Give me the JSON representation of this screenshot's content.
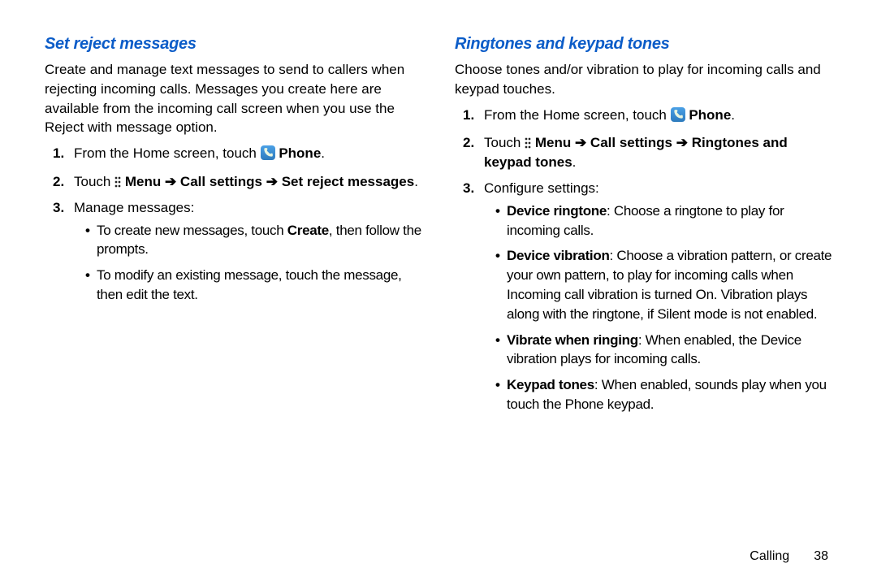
{
  "left": {
    "heading": "Set reject messages",
    "intro": "Create and manage text messages to send to callers when rejecting incoming calls. Messages you create here are available from the incoming call screen when you use the Reject with message option.",
    "s1_a": "From the Home screen, touch ",
    "s1_b": "Phone",
    "s1_c": ".",
    "s2_a": "Touch ",
    "s2_b_menu": "Menu",
    "s2_arrow1": " ➔ ",
    "s2_c": "Call settings",
    "s2_arrow2": " ➔ ",
    "s2_d": "Set reject messages",
    "s2_e": ".",
    "s3": "Manage messages:",
    "s3_b1_a": "To create new messages, touch ",
    "s3_b1_b": "Create",
    "s3_b1_c": ", then follow the prompts.",
    "s3_b2": "To modify an existing message, touch the message, then edit the text."
  },
  "right": {
    "heading": "Ringtones and keypad tones",
    "intro": "Choose tones and/or vibration to play for incoming calls and keypad touches.",
    "s1_a": "From the Home screen, touch ",
    "s1_b": "Phone",
    "s1_c": ".",
    "s2_a": "Touch ",
    "s2_b_menu": "Menu",
    "s2_arrow1": " ➔ ",
    "s2_c": "Call settings",
    "s2_arrow2": " ➔ ",
    "s2_d": "Ringtones and keypad tones",
    "s2_e": ".",
    "s3": "Configure settings:",
    "b1_a": "Device ringtone",
    "b1_b": ": Choose a ringtone to play for incoming calls.",
    "b2_a": "Device vibration",
    "b2_b": ": Choose a vibration pattern, or create your own pattern, to play for incoming calls when Incoming call vibration is turned On. Vibration plays along with the ringtone, if Silent mode is not enabled.",
    "b3_a": "Vibrate when ringing",
    "b3_b": ": When enabled, the Device vibration plays for incoming calls.",
    "b4_a": "Keypad tones",
    "b4_b": ": When enabled, sounds play when you touch the Phone keypad."
  },
  "footer": {
    "section": "Calling",
    "page": "38"
  },
  "numbers": {
    "n1": "1.",
    "n2": "2.",
    "n3": "3."
  }
}
